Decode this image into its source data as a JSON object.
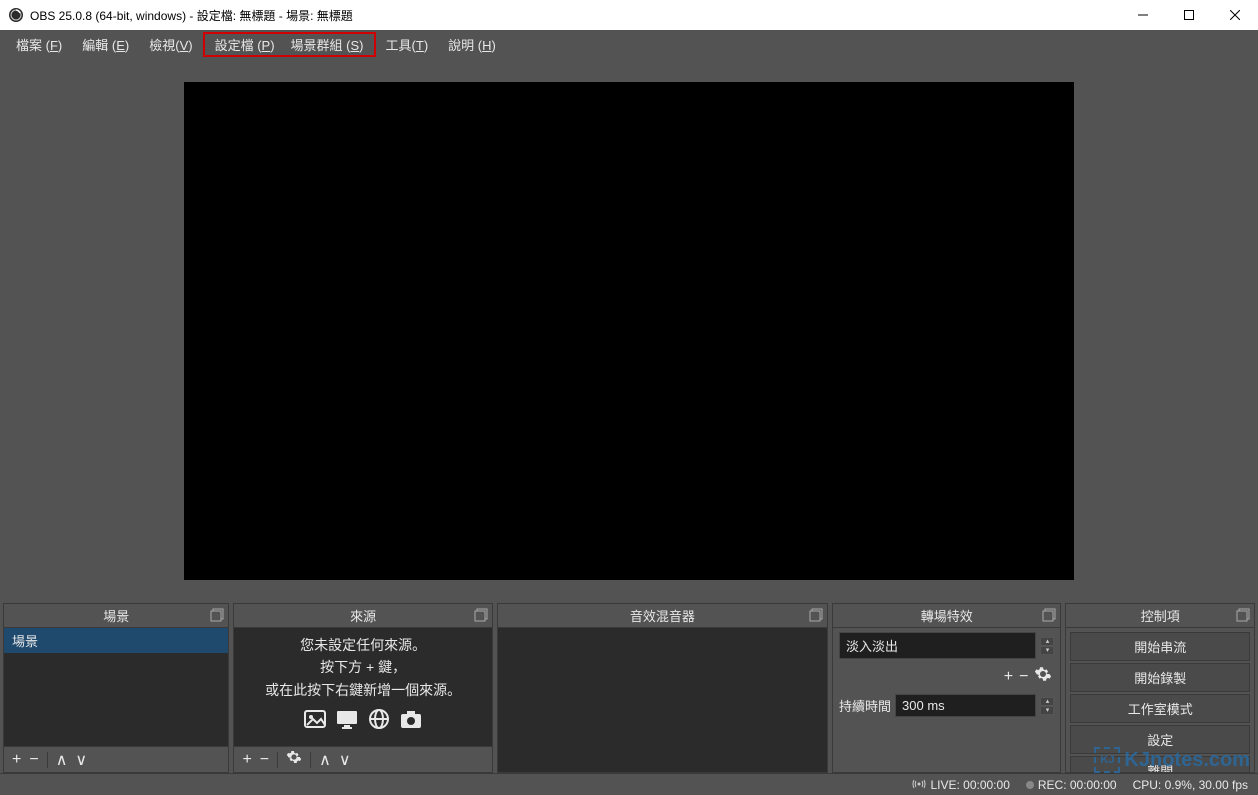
{
  "window": {
    "title": "OBS 25.0.8 (64-bit, windows) - 設定檔: 無標題 - 場景: 無標題"
  },
  "menu": {
    "file": "檔案 (F)",
    "edit": "編輯 (E)",
    "view": "檢視(V)",
    "profile": "設定檔 (P)",
    "scene_collection": "場景群組 (S)",
    "tools": "工具(T)",
    "help": "說明 (H)"
  },
  "docks": {
    "scenes": {
      "title": "場景",
      "items": [
        "場景"
      ]
    },
    "sources": {
      "title": "來源",
      "empty_line1": "您未設定任何來源。",
      "empty_line2": "按下方 + 鍵，",
      "empty_line3": "或在此按下右鍵新增一個來源。"
    },
    "mixer": {
      "title": "音效混音器"
    },
    "transitions": {
      "title": "轉場特效",
      "selected": "淡入淡出",
      "duration_label": "持續時間",
      "duration_value": "300 ms"
    },
    "controls": {
      "title": "控制項",
      "buttons": {
        "start_stream": "開始串流",
        "start_record": "開始錄製",
        "studio_mode": "工作室模式",
        "settings": "設定",
        "exit": "離開"
      }
    }
  },
  "status": {
    "live": "LIVE: 00:00:00",
    "rec": "REC: 00:00:00",
    "cpu": "CPU: 0.9%, 30.00 fps"
  },
  "watermark": "KJnotes.com"
}
